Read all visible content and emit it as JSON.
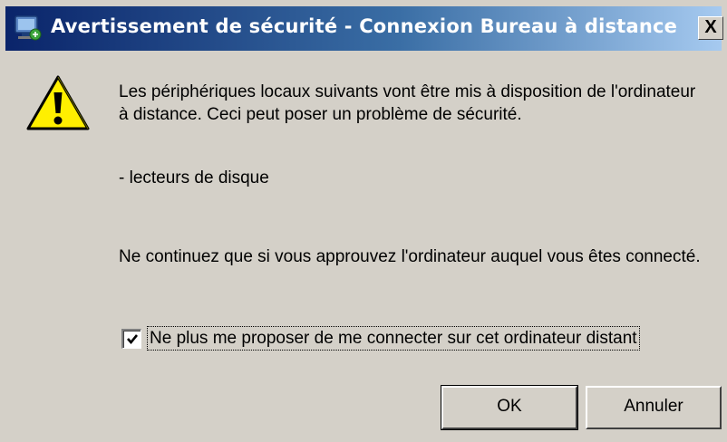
{
  "window": {
    "title": "Avertissement de sécurité - Connexion Bureau à distance",
    "title_icon": "remote-desktop-icon",
    "close_label": "X"
  },
  "dialog": {
    "icon": "warning-icon",
    "message1": "Les périphériques locaux suivants vont être mis à disposition de l'ordinateur à distance. Ceci peut poser un problème de sécurité.",
    "device_list": "- lecteurs de disque",
    "message2": "Ne continuez que si vous approuvez l'ordinateur auquel vous êtes connecté.",
    "checkbox_label": "Ne plus me proposer de me connecter sur cet ordinateur distant",
    "checkbox_checked": true
  },
  "buttons": {
    "ok_label": "OK",
    "cancel_label": "Annuler"
  }
}
